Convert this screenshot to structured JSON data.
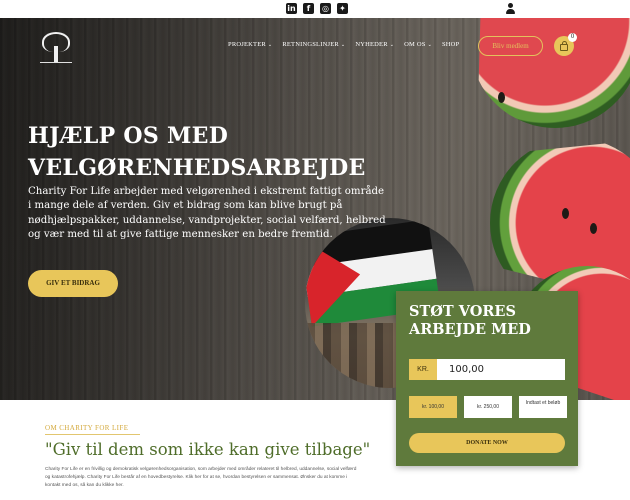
{
  "topbar": {
    "social": [
      {
        "icon": "linkedin-icon",
        "glyph": "in"
      },
      {
        "icon": "facebook-icon",
        "glyph": "f"
      },
      {
        "icon": "instagram-icon",
        "glyph": "◎"
      },
      {
        "icon": "twitter-icon",
        "glyph": "✦"
      }
    ],
    "account_icon": "user-icon"
  },
  "brand": {
    "logo_icon": "tree-icon"
  },
  "nav": {
    "items": [
      {
        "label": "PROJEKTER",
        "has_dropdown": true
      },
      {
        "label": "RETNINGSLINJER",
        "has_dropdown": true
      },
      {
        "label": "NYHEDER",
        "has_dropdown": true
      },
      {
        "label": "OM OS",
        "has_dropdown": true
      },
      {
        "label": "SHOP",
        "has_dropdown": false
      }
    ],
    "chevron": "⌄",
    "member_button": "Bliv medlem",
    "cart_count": "0"
  },
  "hero": {
    "headline_line1": "HJÆLP OS MED",
    "headline_line2": "VELGØRENHEDSARBEJDE",
    "lead": "Charity For Life arbejder med velgørenhed i ekstremt fattigt område i mange dele af verden. Giv et bidrag som kan blive brugt på nødhjælpspakker, uddannelse, vandprojekter, social velfærd, helbred og vær med til at give fattige mennesker en bedre fremtid.",
    "cta": "GIV ET BIDRAG"
  },
  "donation": {
    "title": "STØT VORES ARBEJDE MED",
    "currency": "KR.",
    "amount": "100,00",
    "presets": [
      "kr. 100,00",
      "kr. 250,00",
      "Indtast et beløb"
    ],
    "submit": "DONATE NOW"
  },
  "about": {
    "label": "OM CHARITY FOR LIFE",
    "quote": "\"Giv til dem som ikke kan give tilbage\"",
    "body": "Charity For Life er en frivillig og demokratisk velgørenhedsorganisation, som arbejder med områder relateret til helbred, uddannelse, social velfærd og katastrofehjælp. Charity For Life består af en hovedbestyrelse. Klik her for at se, hvordan bestyrelsen er sammensat. Ønsker du at komme i kontakt med os, så kan du klikke her."
  },
  "colors": {
    "accent_gold": "#e8c65a",
    "panel_green": "#5f7a3c",
    "quote_green": "#4f6d2a"
  }
}
